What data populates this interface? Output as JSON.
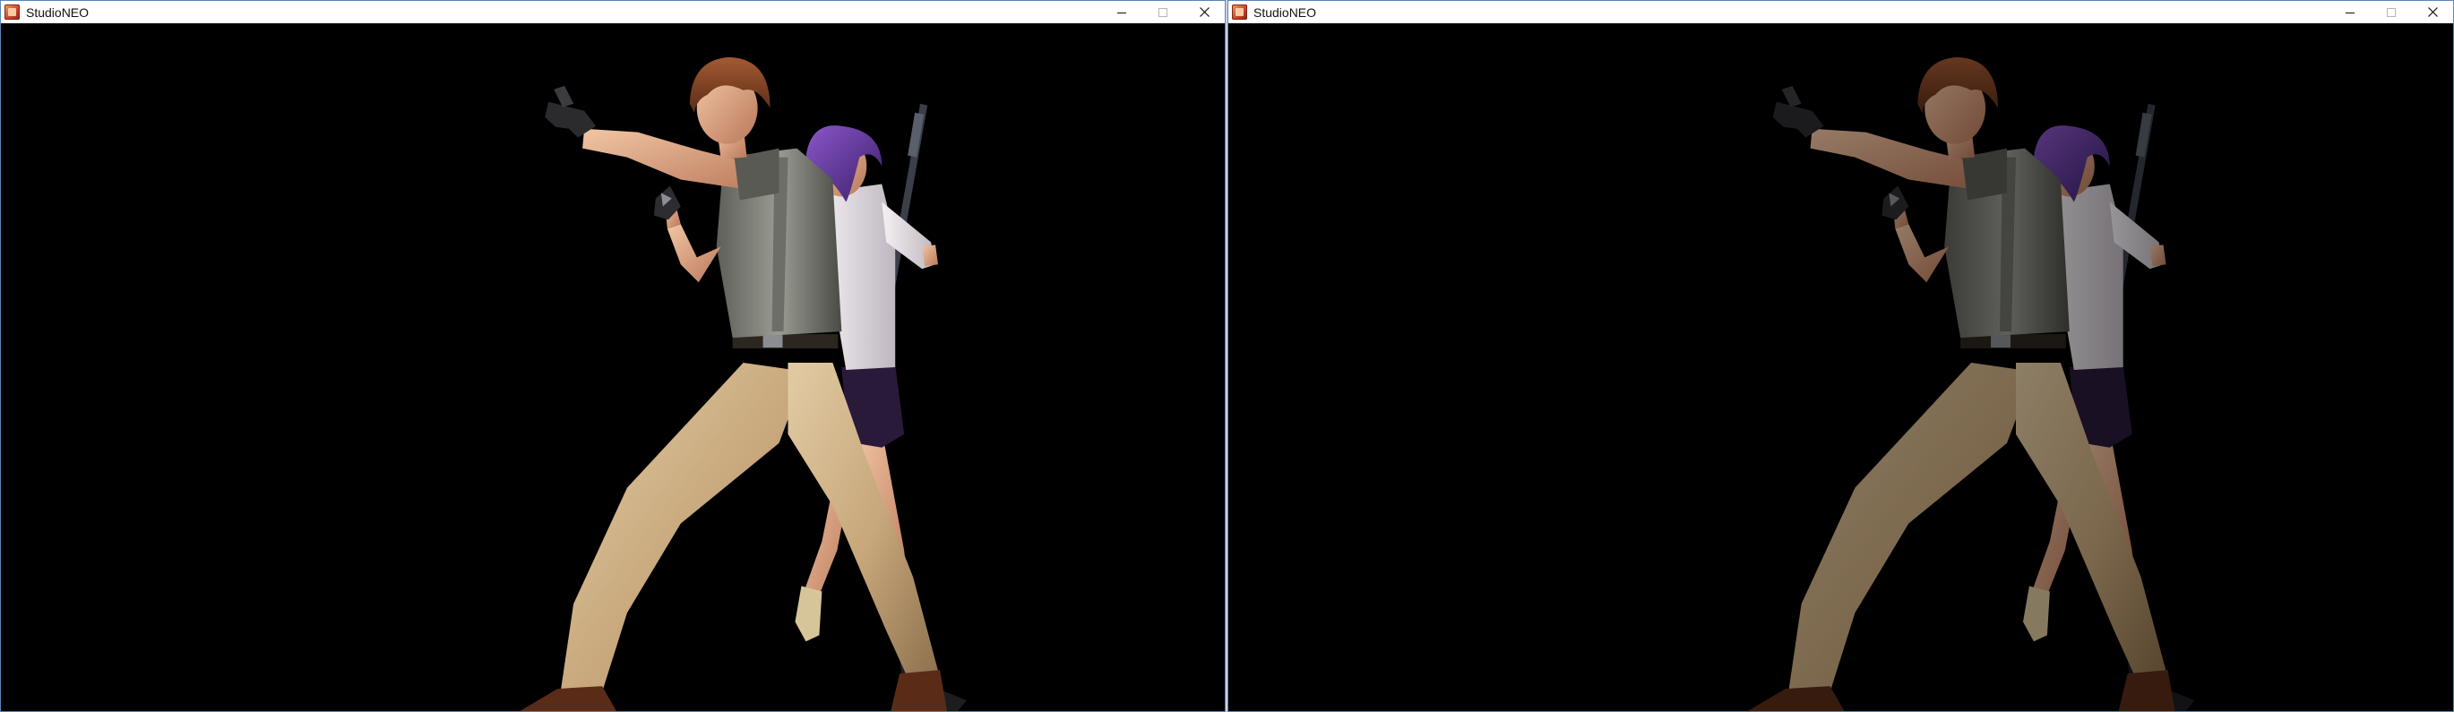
{
  "windows": [
    {
      "title": "StudioNEO",
      "icon": "studioneo-app-icon",
      "controls": [
        "minimize-icon",
        "maximize-icon",
        "close-icon"
      ],
      "viewport_background": "#000000"
    },
    {
      "title": "StudioNEO",
      "icon": "studioneo-app-icon",
      "controls": [
        "minimize-icon",
        "maximize-icon",
        "close-icon"
      ],
      "viewport_background": "#000000"
    }
  ],
  "colors": {
    "window_border": "#5b86b8",
    "titlebar": "#ffffff",
    "viewport": "#000000"
  }
}
